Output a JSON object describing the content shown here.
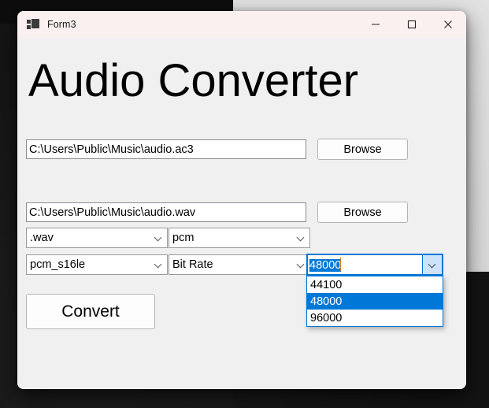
{
  "window": {
    "title": "Form3",
    "icon": "app-form-icon",
    "controls": {
      "minimize": "minimize-icon",
      "maximize": "maximize-icon",
      "close": "close-icon"
    }
  },
  "heading": "Audio Converter",
  "input_row": {
    "path_value": "C:\\Users\\Public\\Music\\audio.ac3",
    "browse_label": "Browse"
  },
  "output_row": {
    "path_value": "C:\\Users\\Public\\Music\\audio.wav",
    "browse_label": "Browse"
  },
  "options": {
    "container_format": {
      "value": ".wav",
      "arrow": "chevron-down-icon"
    },
    "codec_family": {
      "value": "pcm",
      "arrow": "chevron-down-icon"
    },
    "codec": {
      "value": "pcm_s16le",
      "arrow": "chevron-down-icon"
    },
    "rate_kind": {
      "value": "Bit Rate",
      "arrow": "chevron-down-icon"
    },
    "sample_rate": {
      "value": "48000",
      "arrow": "chevron-down-icon",
      "open": true,
      "selected_index": 1,
      "options": [
        "44100",
        "48000",
        "96000"
      ]
    }
  },
  "convert_button": {
    "label": "Convert"
  },
  "colors": {
    "accent": "#0078d7",
    "window_background": "#f0f0f0",
    "titlebar_background": "#faf0f0",
    "selection_text": "#ffffff",
    "caret": "#d07a2a"
  }
}
